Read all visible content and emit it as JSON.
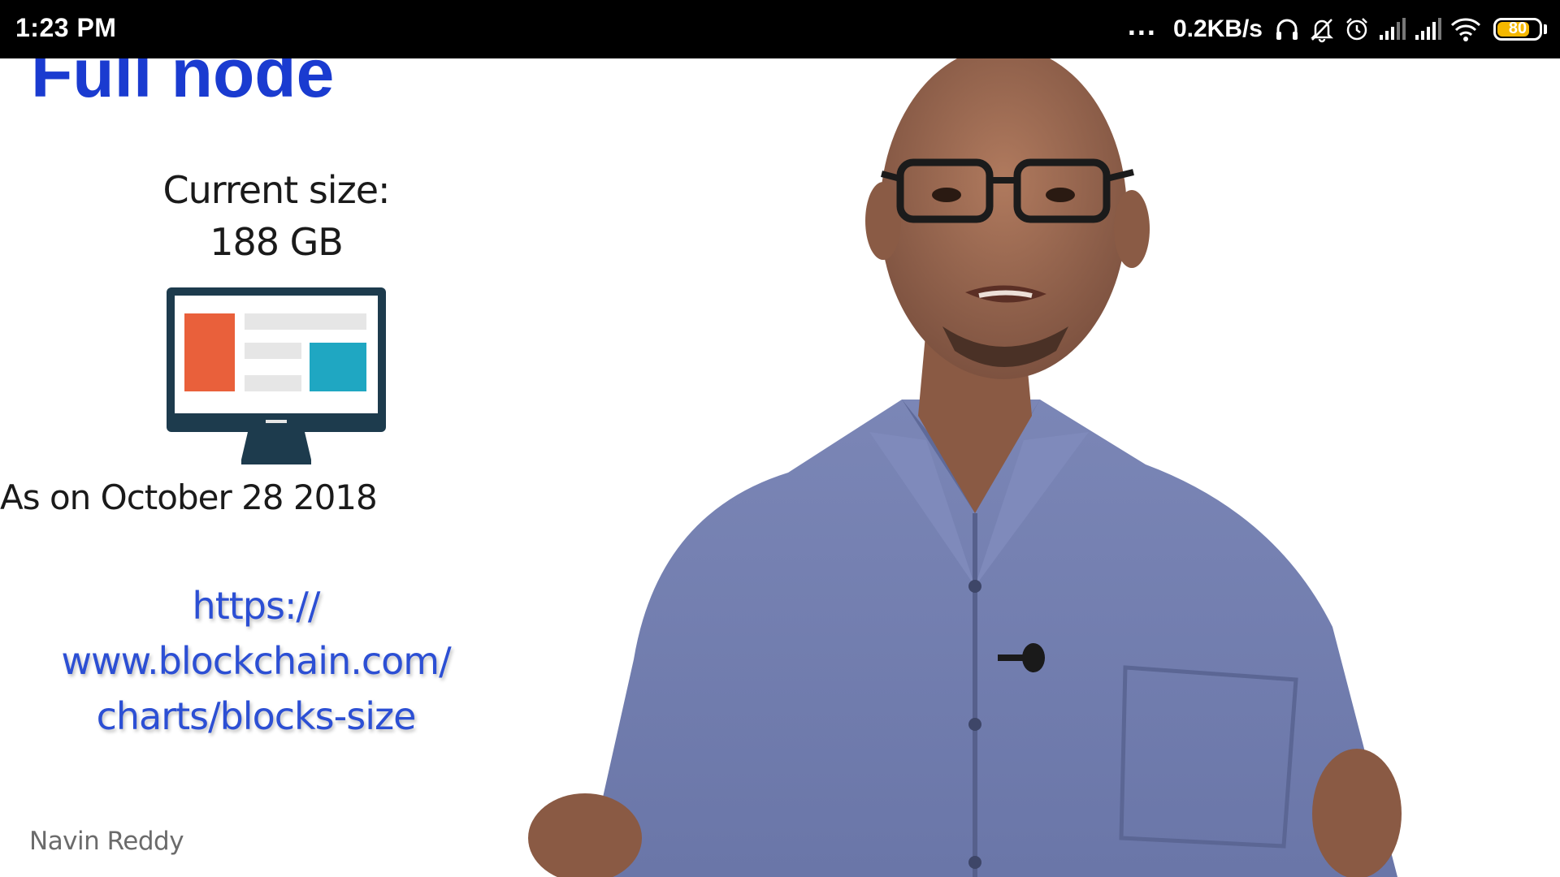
{
  "status_bar": {
    "time": "1:23 PM",
    "overflow_dots": "...",
    "net_speed": "0.2KB/s",
    "icons": [
      "headset-icon",
      "notifications-off-icon",
      "alarm-icon",
      "signal-1-icon",
      "signal-2-icon",
      "wifi-icon"
    ],
    "battery": {
      "level": 80,
      "label": "80",
      "color": "#f5b800"
    }
  },
  "slide": {
    "title": "Full node",
    "size_label": "Current size:",
    "size_value": "188 GB",
    "monitor_icon": "desktop-monitor-icon",
    "date_text": "As on October 28 2018",
    "url_lines": [
      "https://",
      "www.blockchain.com/",
      "charts/blocks-size"
    ],
    "author": "Navin Reddy",
    "colors": {
      "title": "#1a3bd0",
      "url": "#2c4fd4",
      "monitor_frame": "#1d3b4d",
      "panel_orange": "#e9603b",
      "panel_teal": "#1fa7c2"
    }
  }
}
